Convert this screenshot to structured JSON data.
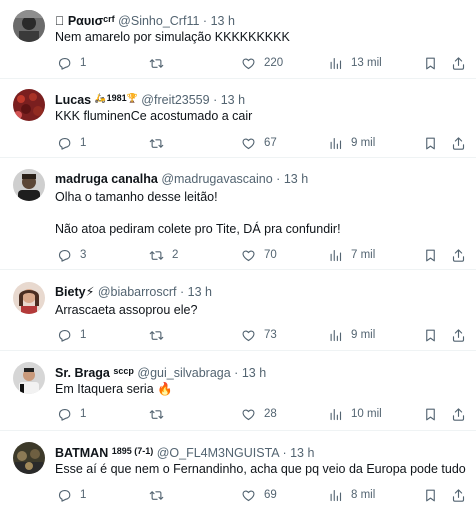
{
  "tweets": [
    {
      "name": " Ραυισ",
      "badge": "crf",
      "handle": "@Sinho_Crf11",
      "dot": "·",
      "time": "13 h",
      "lines": [
        "Nem amarelo por simulação KKKKKKKKK"
      ],
      "replies": "1",
      "retweets": "",
      "likes": "220",
      "views": "13 mil"
    },
    {
      "name": "Lucas",
      "badge": "🛵 1981🏆",
      "handle": "@freit23559",
      "dot": "·",
      "time": "13 h",
      "lines": [
        "KKK fluminenCe acostumado a cair"
      ],
      "replies": "1",
      "retweets": "",
      "likes": "67",
      "views": "9 mil"
    },
    {
      "name": "madruga canalha",
      "badge": "",
      "handle": "@madrugavascaino",
      "dot": "·",
      "time": "13 h",
      "lines": [
        "Olha o tamanho desse leitão!",
        "Não atoa pediram colete pro Tite, DÁ pra confundir!"
      ],
      "replies": "3",
      "retweets": "2",
      "likes": "70",
      "views": "7 mil"
    },
    {
      "name": "Biety⚡",
      "badge": "",
      "handle": "@biabarroscrf",
      "dot": "·",
      "time": "13 h",
      "lines": [
        "Arrascaeta assoprou ele?"
      ],
      "replies": "1",
      "retweets": "",
      "likes": "73",
      "views": "9 mil"
    },
    {
      "name": "Sr. Braga",
      "badge": "sccp",
      "handle": "@gui_silvabraga",
      "dot": "·",
      "time": "13 h",
      "lines": [
        "Em Itaquera seria 🔥"
      ],
      "replies": "1",
      "retweets": "",
      "likes": "28",
      "views": "10 mil"
    },
    {
      "name": "BATMAN",
      "badge": "1895 (7-1)",
      "handle": "@O_FL4M3NGUISTA",
      "dot": "·",
      "time": "13 h",
      "lines": [
        "Esse aí é que nem o Fernandinho, acha que pq veio da Europa pode tudo"
      ],
      "replies": "1",
      "retweets": "",
      "likes": "69",
      "views": "8 mil"
    }
  ],
  "icons": {
    "reply": "reply-icon",
    "retweet": "retweet-icon",
    "like": "heart-icon",
    "views": "views-chart-icon",
    "bookmark": "bookmark-icon",
    "share": "share-icon"
  },
  "colors": {
    "text": "#0f1419",
    "secondary": "#536471",
    "divider": "#eff3f4"
  }
}
